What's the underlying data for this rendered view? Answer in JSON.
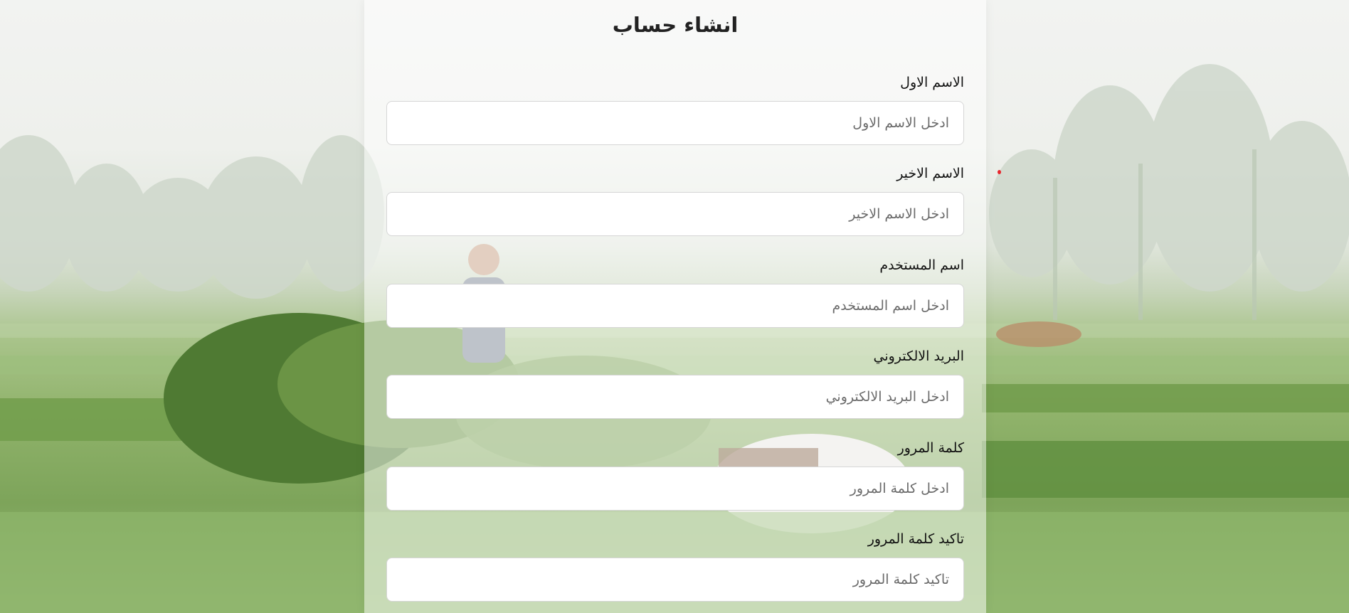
{
  "form": {
    "title": "انشاء حساب",
    "fields": [
      {
        "label": "الاسم الاول",
        "placeholder": "ادخل الاسم الاول",
        "value": ""
      },
      {
        "label": "الاسم الاخير",
        "placeholder": "ادخل الاسم الاخير",
        "value": ""
      },
      {
        "label": "اسم المستخدم",
        "placeholder": "ادخل اسم المستخدم",
        "value": ""
      },
      {
        "label": "البريد الالكتروني",
        "placeholder": "ادخل البريد الالكتروني",
        "value": ""
      },
      {
        "label": "كلمة المرور",
        "placeholder": "ادخل كلمة المرور",
        "value": ""
      },
      {
        "label": "تاكيد كلمة المرور",
        "placeholder": "تاكيد كلمة المرور",
        "value": ""
      }
    ]
  },
  "colors": {
    "accent_dot": "#e8262d",
    "input_border": "#d6d6d6"
  }
}
